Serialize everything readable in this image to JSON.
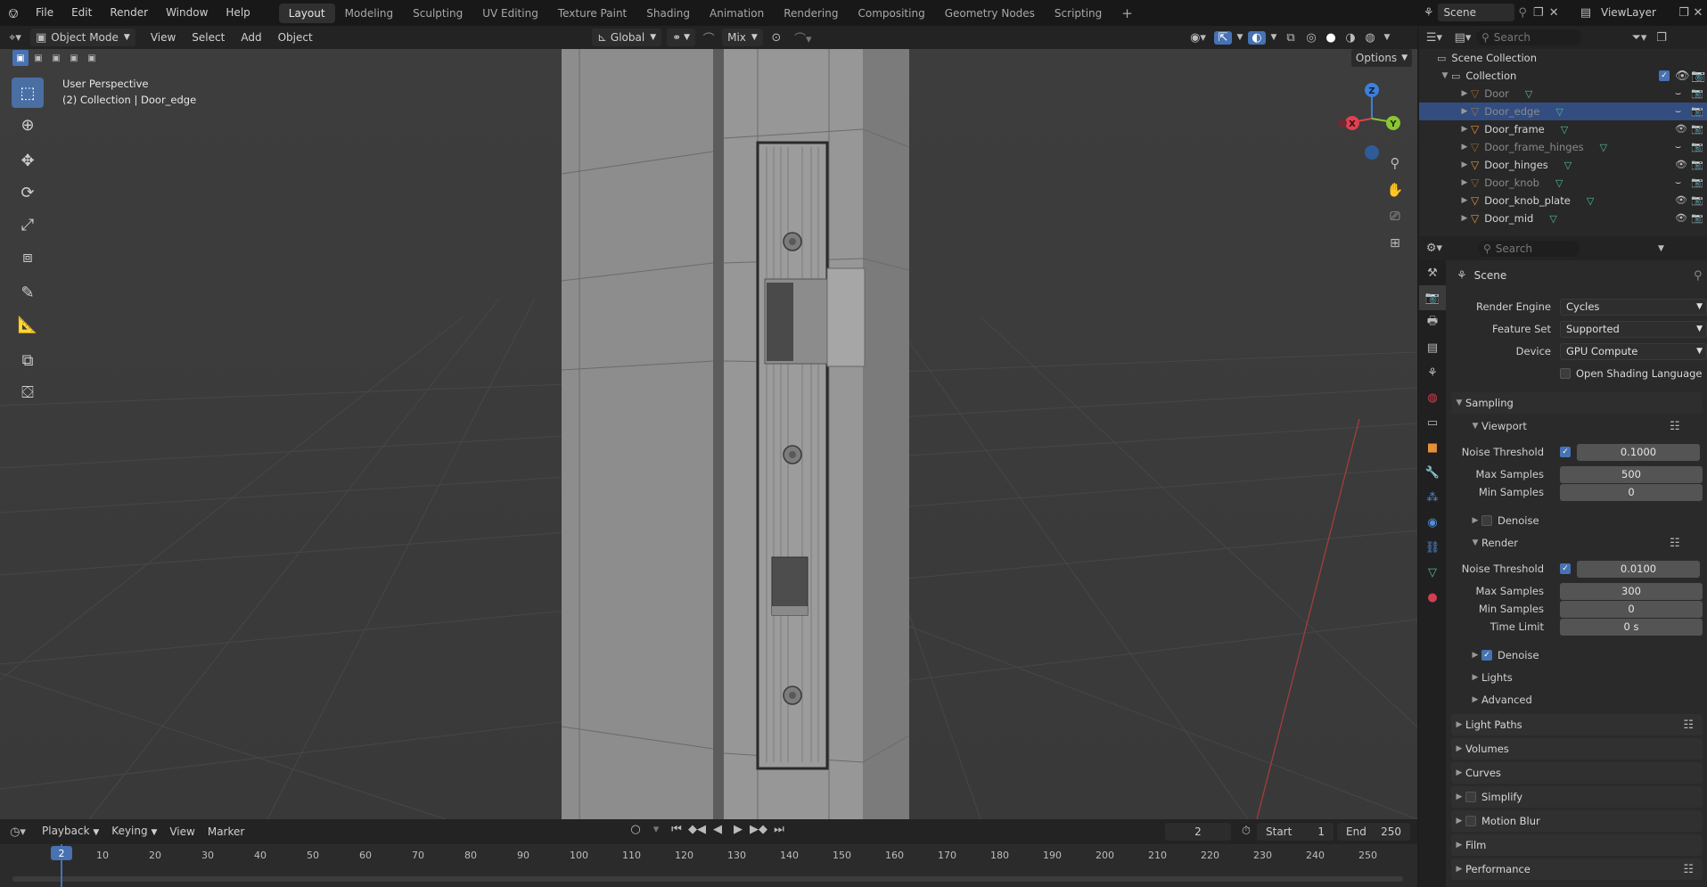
{
  "topbar": {
    "menus": [
      "File",
      "Edit",
      "Render",
      "Window",
      "Help"
    ],
    "workspaces": [
      "Layout",
      "Modeling",
      "Sculpting",
      "UV Editing",
      "Texture Paint",
      "Shading",
      "Animation",
      "Rendering",
      "Compositing",
      "Geometry Nodes",
      "Scripting"
    ],
    "active_workspace": "Layout",
    "add_tab": "+",
    "scene_name": "Scene",
    "view_layer": "ViewLayer"
  },
  "viewport_header": {
    "mode": "Object Mode",
    "menus": [
      "View",
      "Select",
      "Add",
      "Object"
    ],
    "transform_orientation": "Global",
    "snap_mode": "Mix",
    "options_label": "Options"
  },
  "viewport": {
    "perspective_label": "User Perspective",
    "collection_label": "(2) Collection | Door_edge",
    "gizmo": {
      "x": "X",
      "y": "Y",
      "z": "Z"
    }
  },
  "outliner": {
    "search_placeholder": "Search",
    "root": "Scene Collection",
    "collection": "Collection",
    "items": [
      {
        "name": "Door",
        "visible": false,
        "selected": false
      },
      {
        "name": "Door_edge",
        "visible": false,
        "selected": true
      },
      {
        "name": "Door_frame",
        "visible": true,
        "selected": false
      },
      {
        "name": "Door_frame_hinges",
        "visible": false,
        "selected": false
      },
      {
        "name": "Door_hinges",
        "visible": true,
        "selected": false
      },
      {
        "name": "Door_knob",
        "visible": false,
        "selected": false
      },
      {
        "name": "Door_knob_plate",
        "visible": true,
        "selected": false
      },
      {
        "name": "Door_mid",
        "visible": true,
        "selected": false
      }
    ]
  },
  "properties": {
    "search_placeholder": "Search",
    "context": "Scene",
    "render_engine_label": "Render Engine",
    "render_engine": "Cycles",
    "feature_set_label": "Feature Set",
    "feature_set": "Supported",
    "device_label": "Device",
    "device": "GPU Compute",
    "osl_label": "Open Shading Language",
    "sampling": "Sampling",
    "viewport": {
      "label": "Viewport",
      "noise_threshold_label": "Noise Threshold",
      "noise_threshold": "0.1000",
      "max_samples_label": "Max Samples",
      "max_samples": "500",
      "min_samples_label": "Min Samples",
      "min_samples": "0",
      "denoise_label": "Denoise"
    },
    "render": {
      "label": "Render",
      "noise_threshold_label": "Noise Threshold",
      "noise_threshold": "0.0100",
      "max_samples_label": "Max Samples",
      "max_samples": "300",
      "min_samples_label": "Min Samples",
      "min_samples": "0",
      "time_limit_label": "Time Limit",
      "time_limit": "0 s",
      "denoise_label": "Denoise"
    },
    "lights": "Lights",
    "advanced": "Advanced",
    "sections": [
      "Light Paths",
      "Volumes",
      "Curves",
      "Simplify",
      "Motion Blur",
      "Film",
      "Performance"
    ]
  },
  "timeline": {
    "menus": [
      "Playback",
      "Keying",
      "View",
      "Marker"
    ],
    "current_frame": "2",
    "start_label": "Start",
    "start": "1",
    "end_label": "End",
    "end": "250",
    "ruler": [
      "10",
      "20",
      "30",
      "40",
      "50",
      "60",
      "70",
      "80",
      "90",
      "100",
      "110",
      "120",
      "130",
      "140",
      "150",
      "160",
      "170",
      "180",
      "190",
      "200",
      "210",
      "220",
      "230",
      "240",
      "250"
    ],
    "playhead": "2"
  },
  "colors": {
    "accent": "#4772b3",
    "selected_row": "#334d80",
    "mesh_icon": "#e59138",
    "vertex_icon": "#4fbf8f",
    "x_axis": "#e04050",
    "y_axis": "#8ac534",
    "z_axis": "#3d7fd9"
  }
}
